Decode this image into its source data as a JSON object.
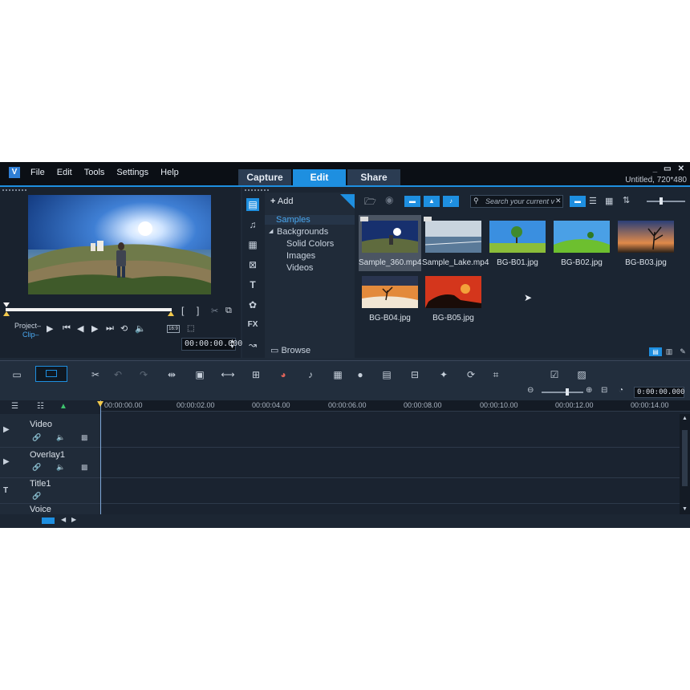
{
  "window": {
    "menu": [
      "File",
      "Edit",
      "Tools",
      "Settings",
      "Help"
    ],
    "tabs": [
      "Capture",
      "Edit",
      "Share"
    ],
    "active_tab": "Edit",
    "project_info": "Untitled, 720*480",
    "controls": [
      "_",
      "▭",
      "✕"
    ]
  },
  "player": {
    "project_label": "Project–",
    "clip_label": "Clip–",
    "timecode": "00:00:00.000",
    "aspect_label": "16:9"
  },
  "library": {
    "add_label": "Add",
    "folders": [
      "Samples",
      "Backgrounds",
      "Solid Colors",
      "Images",
      "Videos"
    ],
    "selected_folder": "Samples",
    "browse_label": "Browse",
    "search_placeholder": "Search your current v",
    "items": [
      "Sample_360.mp4",
      "Sample_Lake.mp4",
      "BG-B01.jpg",
      "BG-B02.jpg",
      "BG-B03.jpg",
      "BG-B04.jpg",
      "BG-B05.jpg"
    ],
    "selected_item": "Sample_360.mp4"
  },
  "timeline": {
    "ruler": [
      "00:00:00.00",
      "00:00:02.00",
      "00:00:04.00",
      "00:00:06.00",
      "00:00:08.00",
      "00:00:10.00",
      "00:00:12.00",
      "00:00:14.00"
    ],
    "zoom_timecode": "0:00:00.000",
    "tracks": [
      "Video",
      "Overlay1",
      "Title1",
      "Voice"
    ]
  },
  "colors": {
    "accent": "#1e8fe0",
    "background": "#1f2a38"
  }
}
